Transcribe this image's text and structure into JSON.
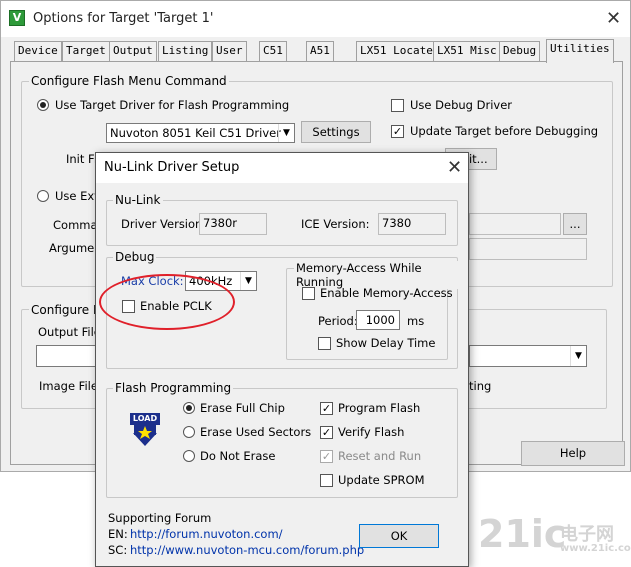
{
  "main_window": {
    "title": "Options for Target 'Target 1'",
    "app_icon": "V",
    "close_glyph": "✕",
    "tabs": [
      "Device",
      "Target",
      "Output",
      "Listing",
      "User",
      "C51",
      "A51",
      "LX51 Locate",
      "LX51 Misc",
      "Debug",
      "Utilities"
    ],
    "active_tab": "Utilities",
    "flash_group": {
      "title": "Configure Flash Menu Command",
      "use_target_driver": "Use Target Driver for Flash Programming",
      "driver_value": "Nuvoton 8051 Keil C51 Driver",
      "settings_label": "Settings",
      "use_debug_driver": "Use Debug Driver",
      "update_target": "Update Target before Debugging",
      "init_file": "Init File",
      "edit_label": "Edit...",
      "use_external": "Use Exte",
      "command": "Comman",
      "arguments": "Argumen",
      "browse_label": "..."
    },
    "image_group": {
      "title": "Configure Ima",
      "output_file": "Output File:",
      "image_files": "Image Files",
      "right_text": "ting"
    },
    "help_label": "Help"
  },
  "dialog": {
    "title": "Nu-Link Driver Setup",
    "close_glyph": "✕",
    "nulink": {
      "title": "Nu-Link",
      "driver_version_label": "Driver Version:",
      "driver_version_value": "7380r",
      "ice_version_label": "ICE Version:",
      "ice_version_value": "7380"
    },
    "debug": {
      "title": "Debug",
      "max_clock_label": "Max Clock:",
      "max_clock_value": "400kHz",
      "enable_pclk": "Enable PCLK"
    },
    "memory_access": {
      "title": "Memory-Access While Running",
      "enable": "Enable Memory-Access",
      "period_label": "Period:",
      "period_value": "1000",
      "period_unit": "ms",
      "show_delay": "Show Delay Time"
    },
    "flash_programming": {
      "title": "Flash Programming",
      "load_icon_text": "LOAD",
      "erase_full": "Erase Full Chip",
      "erase_used": "Erase Used Sectors",
      "do_not_erase": "Do Not Erase",
      "program_flash": "Program Flash",
      "verify_flash": "Verify Flash",
      "reset_and_run": "Reset and Run",
      "update_sprom": "Update SPROM"
    },
    "forum": {
      "title": "Supporting Forum",
      "en_label": "EN:",
      "en_url": "http://forum.nuvoton.com/",
      "sc_label": "SC:",
      "sc_url": "http://www.nuvoton-mcu.com/forum.php"
    },
    "ok_label": "OK"
  },
  "watermark": {
    "brand": "21ic",
    "cn_text": "电子网",
    "url": "www.21ic.com"
  },
  "colors": {
    "annotation": "#e0202a",
    "link": "#0033aa",
    "focus_border": "#0078d7"
  }
}
